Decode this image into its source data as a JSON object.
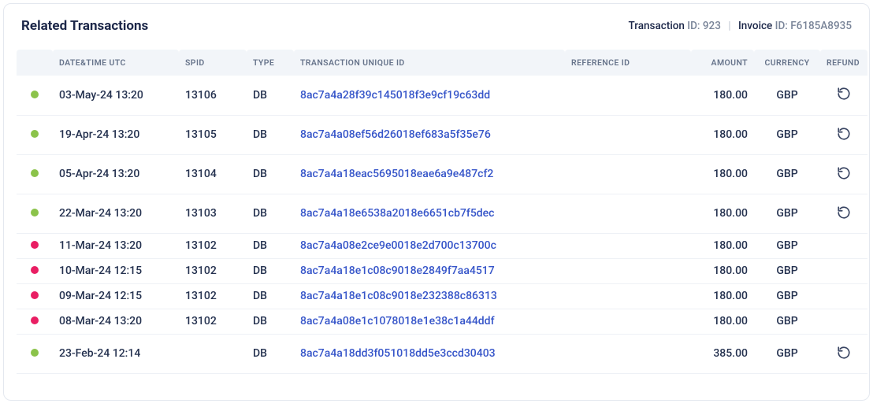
{
  "header": {
    "title": "Related Transactions",
    "txn_label": "Transaction",
    "id_label": "ID:",
    "txn_id": "923",
    "invoice_label": "Invoice",
    "invoice_id": "F6185A8935"
  },
  "columns": {
    "date": "DATE&TIME UTC",
    "spid": "SPID",
    "type": "TYPE",
    "uid": "TRANSACTION UNIQUE ID",
    "ref": "REFERENCE ID",
    "amount": "AMOUNT",
    "currency": "CURRENCY",
    "refund": "REFUND"
  },
  "rows": [
    {
      "status": "green",
      "date": "03-May-24 13:20",
      "spid": "13106",
      "type": "DB",
      "uid": "8ac7a4a28f39c145018f3e9cf19c63dd",
      "ref": "",
      "amount": "180.00",
      "currency": "GBP",
      "refund": true,
      "short": false
    },
    {
      "status": "green",
      "date": "19-Apr-24 13:20",
      "spid": "13105",
      "type": "DB",
      "uid": "8ac7a4a08ef56d26018ef683a5f35e76",
      "ref": "",
      "amount": "180.00",
      "currency": "GBP",
      "refund": true,
      "short": false
    },
    {
      "status": "green",
      "date": "05-Apr-24 13:20",
      "spid": "13104",
      "type": "DB",
      "uid": "8ac7a4a18eac5695018eae6a9e487cf2",
      "ref": "",
      "amount": "180.00",
      "currency": "GBP",
      "refund": true,
      "short": false
    },
    {
      "status": "green",
      "date": "22-Mar-24 13:20",
      "spid": "13103",
      "type": "DB",
      "uid": "8ac7a4a18e6538a2018e6651cb7f5dec",
      "ref": "",
      "amount": "180.00",
      "currency": "GBP",
      "refund": true,
      "short": false
    },
    {
      "status": "red",
      "date": "11-Mar-24 13:20",
      "spid": "13102",
      "type": "DB",
      "uid": "8ac7a4a08e2ce9e0018e2d700c13700c",
      "ref": "",
      "amount": "180.00",
      "currency": "GBP",
      "refund": false,
      "short": true
    },
    {
      "status": "red",
      "date": "10-Mar-24 12:15",
      "spid": "13102",
      "type": "DB",
      "uid": "8ac7a4a18e1c08c9018e2849f7aa4517",
      "ref": "",
      "amount": "180.00",
      "currency": "GBP",
      "refund": false,
      "short": true
    },
    {
      "status": "red",
      "date": "09-Mar-24 12:15",
      "spid": "13102",
      "type": "DB",
      "uid": "8ac7a4a18e1c08c9018e232388c86313",
      "ref": "",
      "amount": "180.00",
      "currency": "GBP",
      "refund": false,
      "short": true
    },
    {
      "status": "red",
      "date": "08-Mar-24 13:20",
      "spid": "13102",
      "type": "DB",
      "uid": "8ac7a4a08e1c1078018e1e38c1a44ddf",
      "ref": "",
      "amount": "180.00",
      "currency": "GBP",
      "refund": false,
      "short": true
    },
    {
      "status": "green",
      "date": "23-Feb-24 12:14",
      "spid": "",
      "type": "DB",
      "uid": "8ac7a4a18dd3f051018dd5e3ccd30403",
      "ref": "",
      "amount": "385.00",
      "currency": "GBP",
      "refund": true,
      "short": false
    }
  ]
}
